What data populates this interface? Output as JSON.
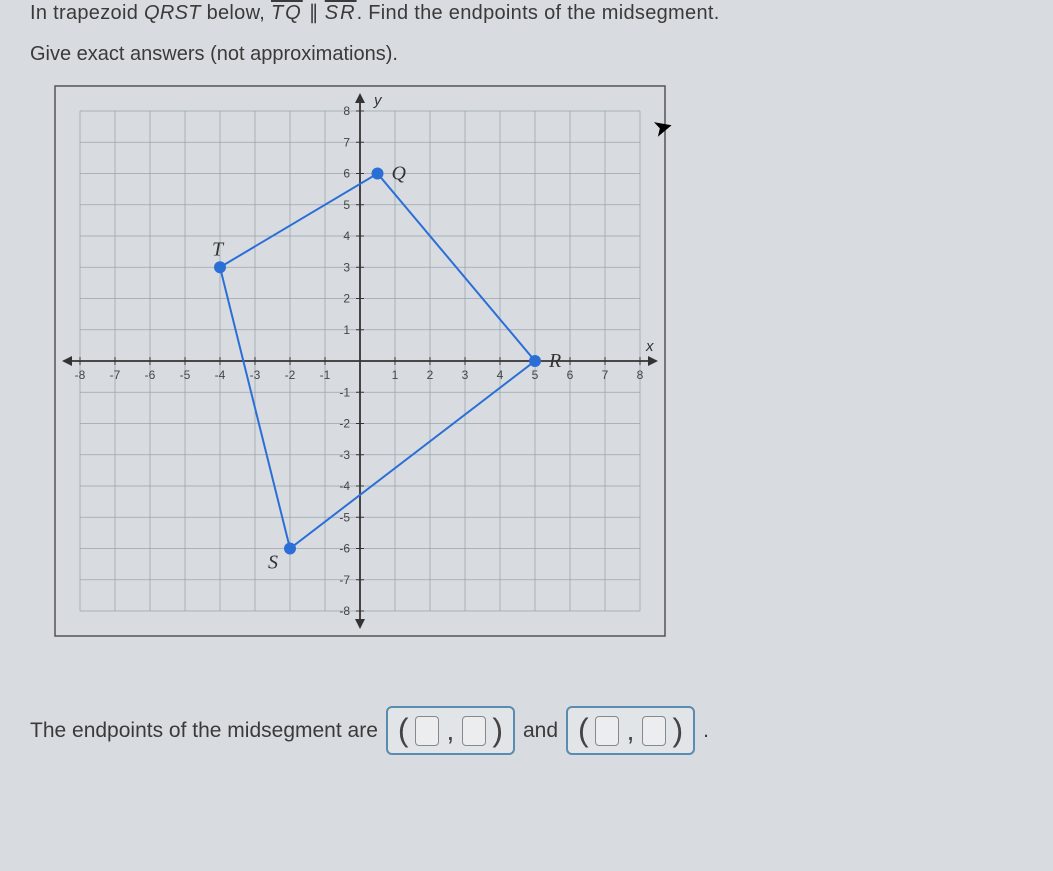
{
  "problem": {
    "prefix": "In trapezoid ",
    "shape": "QRST",
    "mid1": " below, ",
    "seg1": "TQ",
    "parallel": " ∥ ",
    "seg2": "SR",
    "suffix": ". Find the endpoints of the midsegment."
  },
  "instruction": "Give exact answers (not approximations).",
  "chart_data": {
    "type": "scatter",
    "title": "",
    "xlabel": "x",
    "ylabel": "y",
    "xlim": [
      -8,
      8
    ],
    "ylim": [
      -8,
      8
    ],
    "x_ticks": [
      -8,
      -7,
      -6,
      -5,
      -4,
      -3,
      -2,
      -1,
      1,
      2,
      3,
      4,
      5,
      6,
      7,
      8
    ],
    "y_ticks": [
      -8,
      -7,
      -6,
      -5,
      -4,
      -3,
      -2,
      -1,
      1,
      2,
      3,
      4,
      5,
      6,
      7,
      8
    ],
    "points": [
      {
        "name": "Q",
        "x": 0.5,
        "y": 6
      },
      {
        "name": "R",
        "x": 5,
        "y": 0
      },
      {
        "name": "S",
        "x": -2,
        "y": -6
      },
      {
        "name": "T",
        "x": -4,
        "y": 3
      }
    ],
    "polygon_order": [
      "Q",
      "R",
      "S",
      "T"
    ],
    "label_positions": {
      "Q": "right",
      "R": "right",
      "S": "left-below",
      "T": "above-left"
    }
  },
  "answer": {
    "lead": "The endpoints of the midsegment are",
    "connector": "and",
    "period": "."
  }
}
